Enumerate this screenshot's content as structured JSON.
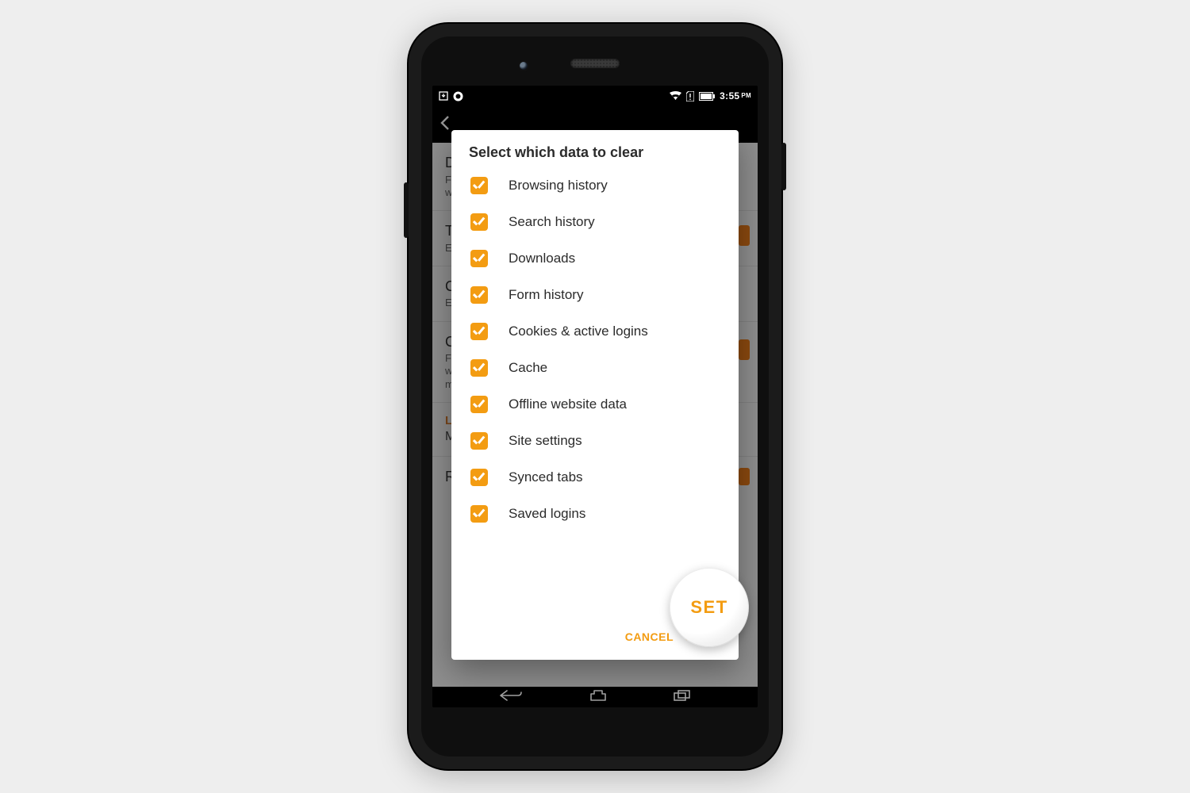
{
  "status": {
    "clock": "3:55",
    "ampm": "PM"
  },
  "dialog": {
    "title": "Select which data to clear",
    "options": [
      {
        "label": "Browsing history",
        "checked": true
      },
      {
        "label": "Search history",
        "checked": true
      },
      {
        "label": "Downloads",
        "checked": true
      },
      {
        "label": "Form history",
        "checked": true
      },
      {
        "label": "Cookies & active logins",
        "checked": true
      },
      {
        "label": "Cache",
        "checked": true
      },
      {
        "label": "Offline website data",
        "checked": true
      },
      {
        "label": "Site settings",
        "checked": true
      },
      {
        "label": "Synced tabs",
        "checked": true
      },
      {
        "label": "Saved logins",
        "checked": true
      }
    ],
    "cancel": "CANCEL",
    "confirm": "SET"
  },
  "background": {
    "section1_title": "D",
    "section1_sub1": "F",
    "section1_sub2": "w",
    "section2_title": "T",
    "section2_sub": "E",
    "section3_title": "C",
    "section3_sub": "E",
    "section4_title": "C",
    "section4_sub1": "F",
    "section4_sub2": "w",
    "section4_sub3": "m",
    "logins_header": "L",
    "logins_sub": "M",
    "remember_logins": "Remember logins"
  },
  "highlight_label": "SET"
}
